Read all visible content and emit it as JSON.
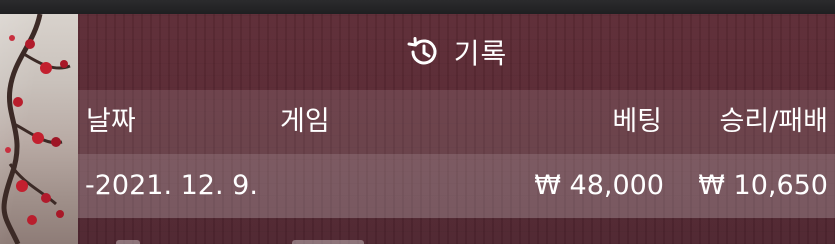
{
  "header": {
    "title": "기록",
    "icon": "history-icon"
  },
  "table": {
    "columns": [
      "날짜",
      "게임",
      "베팅",
      "승리/패배"
    ],
    "rows": [
      {
        "date": "-2021. 12. 9.",
        "game": "",
        "bet": "₩ 48,000",
        "result": "₩ 10,650"
      }
    ]
  },
  "colors": {
    "panel": "#5a2a34",
    "text": "#ffffff"
  }
}
